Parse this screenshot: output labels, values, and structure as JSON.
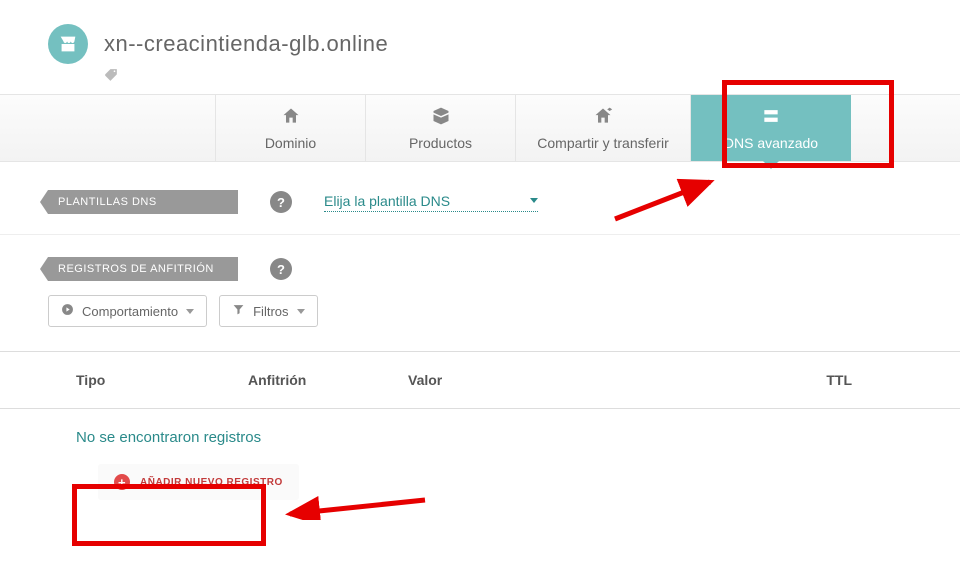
{
  "header": {
    "domain": "xn--creacintienda-glb.online"
  },
  "tabs": {
    "dominio": "Dominio",
    "productos": "Productos",
    "compartir": "Compartir y transferir",
    "dns": "DNS avanzado"
  },
  "sections": {
    "plantillas_label": "PLANTILLAS DNS",
    "plantillas_select": "Elija la plantilla DNS",
    "registros_label": "REGISTROS DE ANFITRIÓN",
    "help": "?"
  },
  "filters": {
    "comportamiento": "Comportamiento",
    "filtros": "Filtros"
  },
  "table": {
    "tipo": "Tipo",
    "anfitrion": "Anfitrión",
    "valor": "Valor",
    "ttl": "TTL",
    "empty": "No se encontraron registros",
    "add": "AÑADIR NUEVO REGISTRO"
  }
}
